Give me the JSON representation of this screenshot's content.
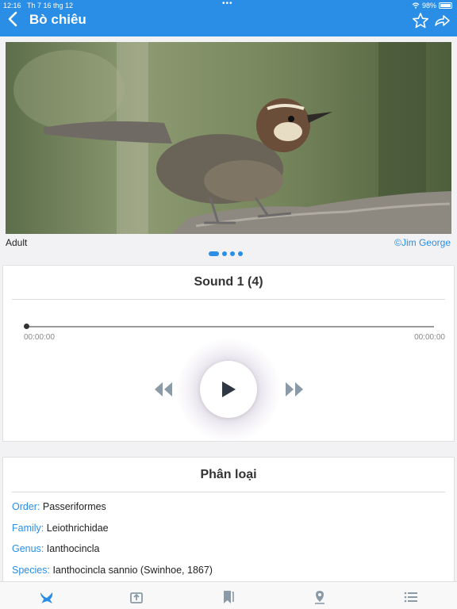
{
  "status": {
    "time": "12:16",
    "date": "Th 7 16 thg 12",
    "dots": "•••",
    "battery": "98%"
  },
  "nav": {
    "title": "Bò chiêu"
  },
  "photo": {
    "caption": "Adult",
    "credit": "©Jim George",
    "page_count": 4,
    "current_page": 1
  },
  "sound": {
    "title": "Sound 1 (4)",
    "elapsed": "00:00:00",
    "duration": "00:00:00",
    "progress": 0
  },
  "taxonomy": {
    "title": "Phân loại",
    "rows": [
      {
        "key": "Order:",
        "value": "Passeriformes"
      },
      {
        "key": "Family:",
        "value": "Leiothrichidae"
      },
      {
        "key": "Genus:",
        "value": "Ianthocincla"
      },
      {
        "key": "Species:",
        "value": "Ianthocincla sannio (Swinhoe, 1867)"
      }
    ]
  },
  "colors": {
    "accent": "#2a8ee6",
    "nav_bg": "#2a8ee6",
    "control_grey": "#8a9aa6"
  },
  "tabs": [
    "bird-icon",
    "export-icon",
    "bookmarks-icon",
    "location-icon",
    "list-icon"
  ]
}
